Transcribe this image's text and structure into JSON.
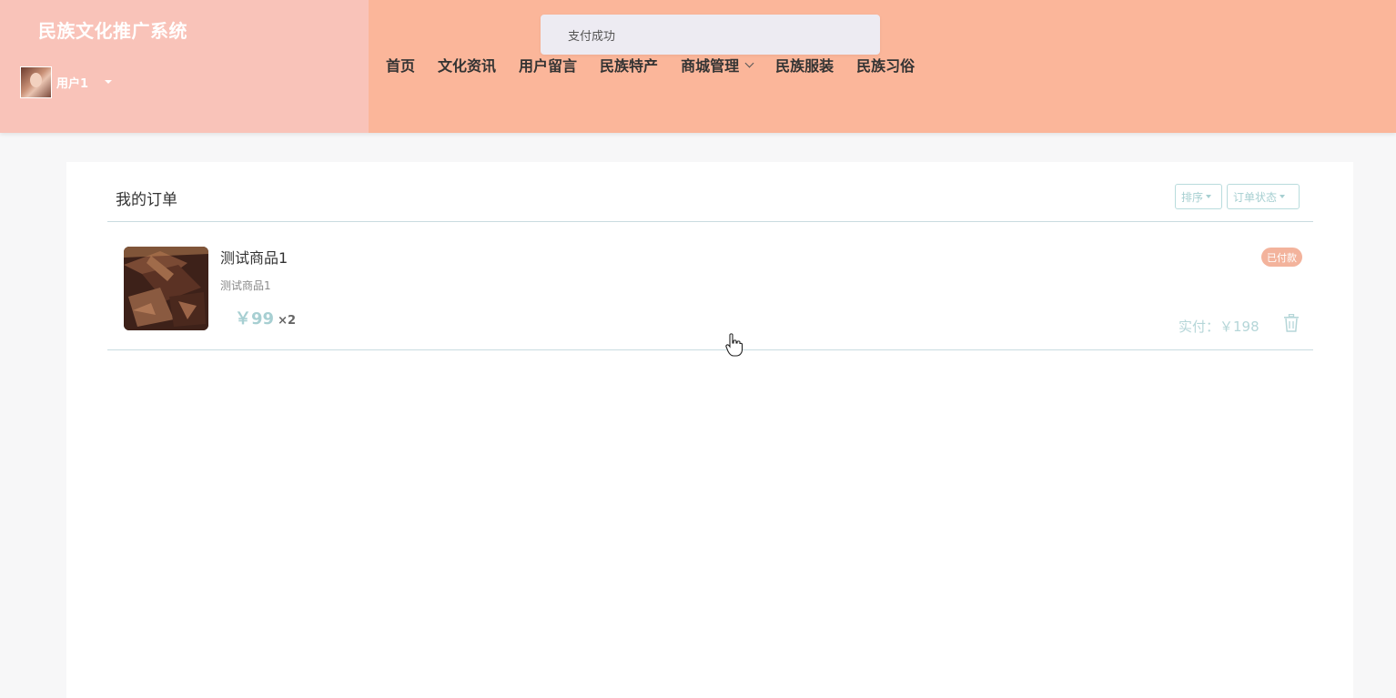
{
  "header": {
    "brand_title": "民族文化推广系统",
    "user": {
      "name": "用户1",
      "avatar_icon": "user-avatar-photo"
    },
    "nav": [
      {
        "label": "首页"
      },
      {
        "label": "文化资讯"
      },
      {
        "label": "用户留言"
      },
      {
        "label": "民族特产"
      },
      {
        "label": "商城管理",
        "has_dropdown": true
      },
      {
        "label": "民族服装"
      },
      {
        "label": "民族习俗"
      }
    ],
    "colors": {
      "header_bg": "#fbb69a",
      "brand_bg": "#f9c3b9"
    }
  },
  "toast": {
    "message": "支付成功"
  },
  "orders": {
    "title": "我的订单",
    "sort_label": "排序",
    "status_filter_label": "订单状态",
    "items": [
      {
        "name": "测试商品1",
        "description": "测试商品1",
        "price": "￥99",
        "quantity": "×2",
        "status": "已付款",
        "paid_total": "实付：￥198"
      }
    ],
    "colors": {
      "accent": "#a7cfd2",
      "status_badge": "#f3b39c"
    }
  }
}
